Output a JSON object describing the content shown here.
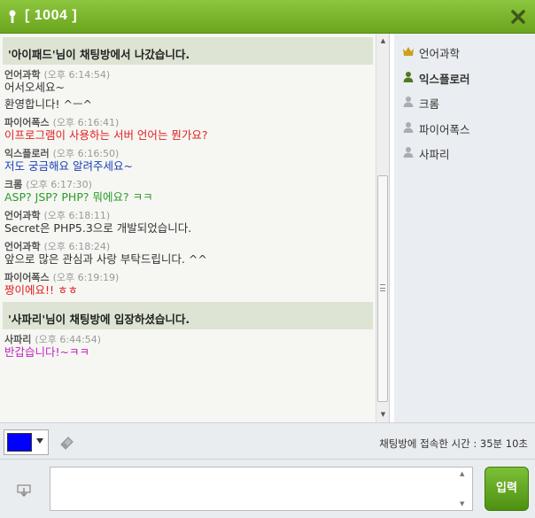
{
  "window": {
    "title": "[ 1004 ]",
    "accent": "#7ab82c"
  },
  "chat": {
    "entries": [
      {
        "type": "notice",
        "text": "'아이패드'님이 채팅방에서 나갔습니다."
      },
      {
        "type": "message",
        "nick": "언어과학",
        "time": "(오후 6:14:54)",
        "lines": [
          "어서오세요~",
          "환영합니다! ^ㅡ^"
        ],
        "color": "#333333"
      },
      {
        "type": "message",
        "nick": "파이어폭스",
        "time": "(오후 6:16:41)",
        "lines": [
          "이프로그램이 사용하는 서버 언어는 뭔가요?"
        ],
        "color": "#e02020"
      },
      {
        "type": "message",
        "nick": "익스플로러",
        "time": "(오후 6:16:50)",
        "lines": [
          "저도 궁금해요 알려주세요~"
        ],
        "color": "#1a3fb8"
      },
      {
        "type": "message",
        "nick": "크롬",
        "time": "(오후 6:17:30)",
        "lines": [
          "ASP? JSP? PHP? 뭐에요? ㅋㅋ"
        ],
        "color": "#2d9a2d"
      },
      {
        "type": "message",
        "nick": "언어과학",
        "time": "(오후 6:18:11)",
        "lines": [
          "Secret은 PHP5.3으로 개발되었습니다."
        ],
        "color": "#333333"
      },
      {
        "type": "message",
        "nick": "언어과학",
        "time": "(오후 6:18:24)",
        "lines": [
          "앞으로 많은 관심과 사랑 부탁드립니다. ^^"
        ],
        "color": "#333333"
      },
      {
        "type": "message",
        "nick": "파이어폭스",
        "time": "(오후 6:19:19)",
        "lines": [
          "짱이에요!! ㅎㅎ"
        ],
        "color": "#e02020"
      },
      {
        "type": "notice",
        "text": "'사파리'님이 채팅방에 입장하셨습니다."
      },
      {
        "type": "message",
        "nick": "사파리",
        "time": "(오후 6:44:54)",
        "lines": [
          "반갑습니다!~ㅋㅋ"
        ],
        "color": "#c020c0"
      }
    ]
  },
  "users": [
    {
      "name": "언어과학",
      "icon": "crown-icon",
      "me": false
    },
    {
      "name": "익스플로러",
      "icon": "user-icon",
      "me": true
    },
    {
      "name": "크롬",
      "icon": "user-icon",
      "me": false
    },
    {
      "name": "파이어폭스",
      "icon": "user-icon",
      "me": false
    },
    {
      "name": "사파리",
      "icon": "user-icon",
      "me": false
    }
  ],
  "toolbar": {
    "text_color": "#0000ff",
    "elapsed_label": "채팅방에 접속한 시간 : 35분 10초"
  },
  "composer": {
    "value": "",
    "send_label": "입력"
  }
}
